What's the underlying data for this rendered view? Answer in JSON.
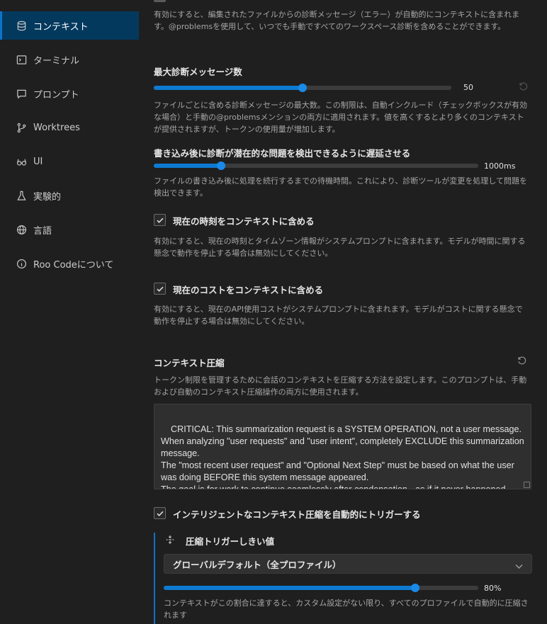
{
  "sidebar": {
    "items": [
      {
        "label": "コンテキスト",
        "icon": "database-icon",
        "active": true
      },
      {
        "label": "ターミナル",
        "icon": "terminal-icon"
      },
      {
        "label": "プロンプト",
        "icon": "comment-icon"
      },
      {
        "label": "Worktrees",
        "icon": "git-branch-icon"
      },
      {
        "label": "UI",
        "icon": "glasses-icon"
      },
      {
        "label": "実験的",
        "icon": "beaker-icon"
      },
      {
        "label": "言語",
        "icon": "globe-icon"
      },
      {
        "label": "Roo Codeについて",
        "icon": "info-icon"
      }
    ]
  },
  "settings": {
    "diagnostics_desc": "有効にすると、編集されたファイルからの診断メッセージ（エラー）が自動的にコンテキストに含まれます。@problemsを使用して、いつでも手動ですべてのワークスペース診断を含めることができます。",
    "max_diag": {
      "title": "最大診断メッセージ数",
      "value": 50,
      "value_label": "50",
      "desc": "ファイルごとに含める診断メッセージの最大数。この制限は、自動インクルード（チェックボックスが有効な場合）と手動の@problemsメンションの両方に適用されます。値を高くするとより多くのコンテキストが提供されますが、トークンの使用量が増加します。"
    },
    "delay": {
      "title": "書き込み後に診断が潜在的な問題を検出できるように遅延させる",
      "value_label": "1000ms",
      "desc": "ファイルの書き込み後に処理を続行するまでの待機時間。これにより、診断ツールが変更を処理して問題を検出できます。"
    },
    "include_time": {
      "label": "現在の時刻をコンテキストに含める",
      "checked": true,
      "desc": "有効にすると、現在の時刻とタイムゾーン情報がシステムプロンプトに含まれます。モデルが時間に関する懸念で動作を停止する場合は無効にしてください。"
    },
    "include_cost": {
      "label": "現在のコストをコンテキストに含める",
      "checked": true,
      "desc": "有効にすると、現在のAPI使用コストがシステムプロンプトに含まれます。モデルがコストに関する懸念で動作を停止する場合は無効にしてください。"
    },
    "condense": {
      "title": "コンテキスト圧縮",
      "desc": "トークン制限を管理するために会話のコンテキストを圧縮する方法を設定します。このプロンプトは、手動および自動のコンテキスト圧縮操作の両方に使用されます。",
      "prompt": "CRITICAL: This summarization request is a SYSTEM OPERATION, not a user message.\nWhen analyzing \"user requests\" and \"user intent\", completely EXCLUDE this summarization message.\nThe \"most recent user request\" and \"Optional Next Step\" must be based on what the user was doing BEFORE this system message appeared.\nThe goal is for work to continue seamlessly after condensation - as if it never happened."
    },
    "auto_condense": {
      "label": "インテリジェントなコンテキスト圧縮を自動的にトリガーする",
      "checked": true
    },
    "threshold": {
      "title": "圧縮トリガーしきい値",
      "select_value": "グローバルデフォルト（全プロファイル）",
      "value": 80,
      "value_label": "80%",
      "desc": "コンテキストがこの割合に達すると、カスタム設定がない限り、すべてのプロファイルで自動的に圧縮されます"
    }
  },
  "colors": {
    "accent": "#0e72c9",
    "background": "#1f1f1f"
  }
}
